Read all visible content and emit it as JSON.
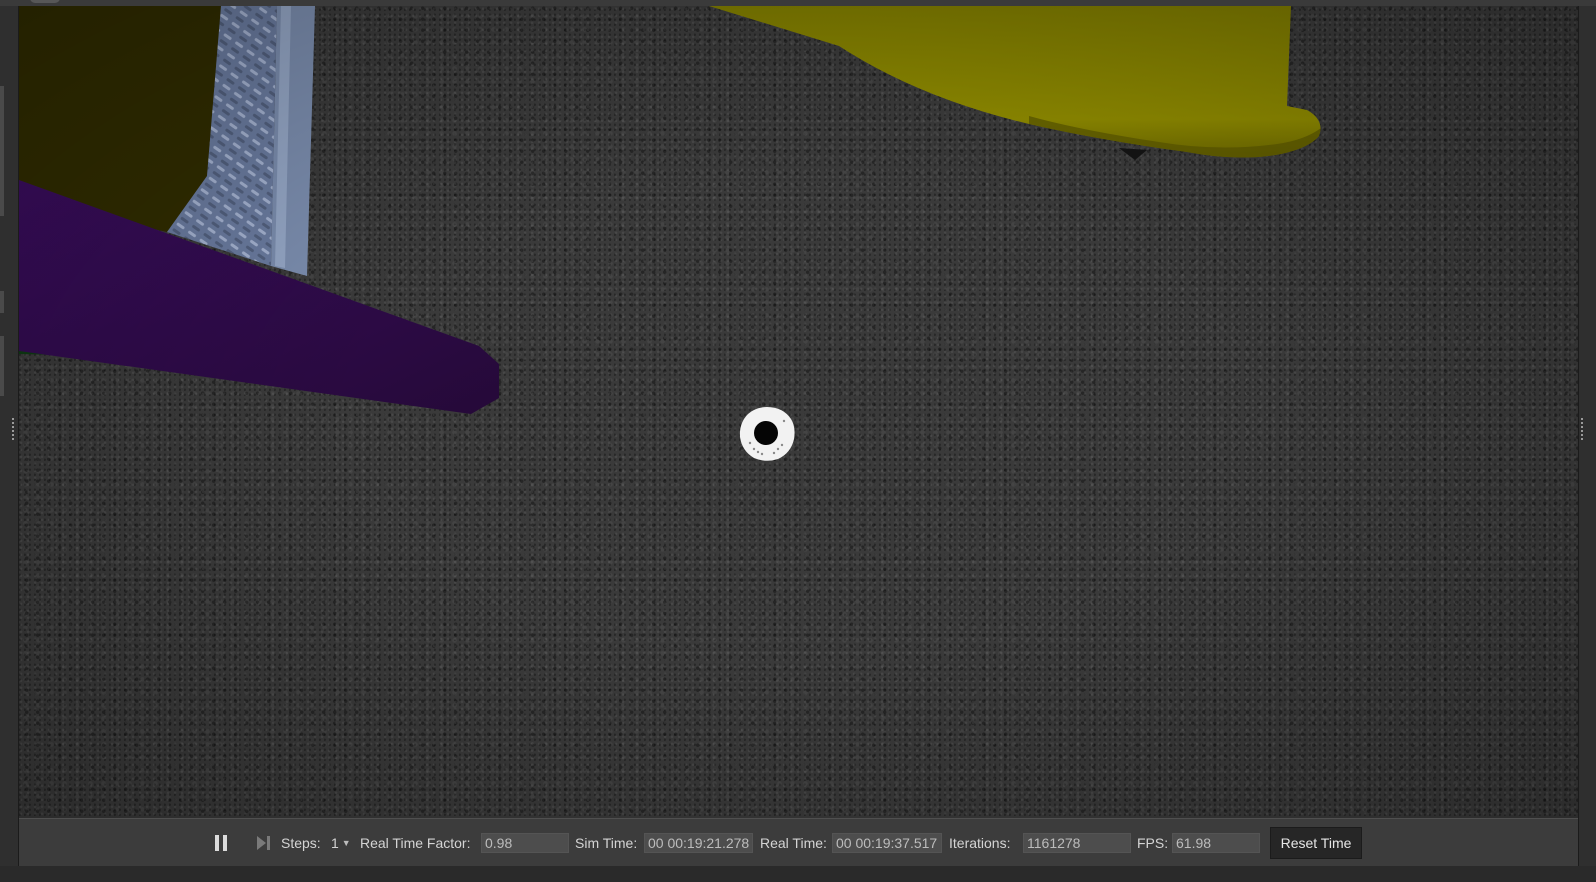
{
  "toolbar": {
    "steps_label": "Steps:",
    "steps_value": "1",
    "rtf_label": "Real Time Factor:",
    "rtf_value": "0.98",
    "sim_time_label": "Sim Time:",
    "sim_time_value": "00 00:19:21.278",
    "real_time_label": "Real Time:",
    "real_time_value": "00 00:19:37.517",
    "iterations_label": "Iterations:",
    "iterations_value": "1161278",
    "fps_label": "FPS:",
    "fps_value": "61.98",
    "reset_label": "Reset Time"
  },
  "icons": {
    "pause": "pause-icon",
    "step": "step-forward-icon",
    "steps_dropdown": "chevron-down-icon"
  },
  "scene": {
    "ground": "asphalt",
    "colors": {
      "asphalt": "#3a3a3a",
      "dark_olive": "#302b00",
      "purple": "#2e0b4a",
      "yellow": "#7c7800",
      "green_edge": "#0f3a12",
      "steel": "#6e82a8"
    }
  }
}
